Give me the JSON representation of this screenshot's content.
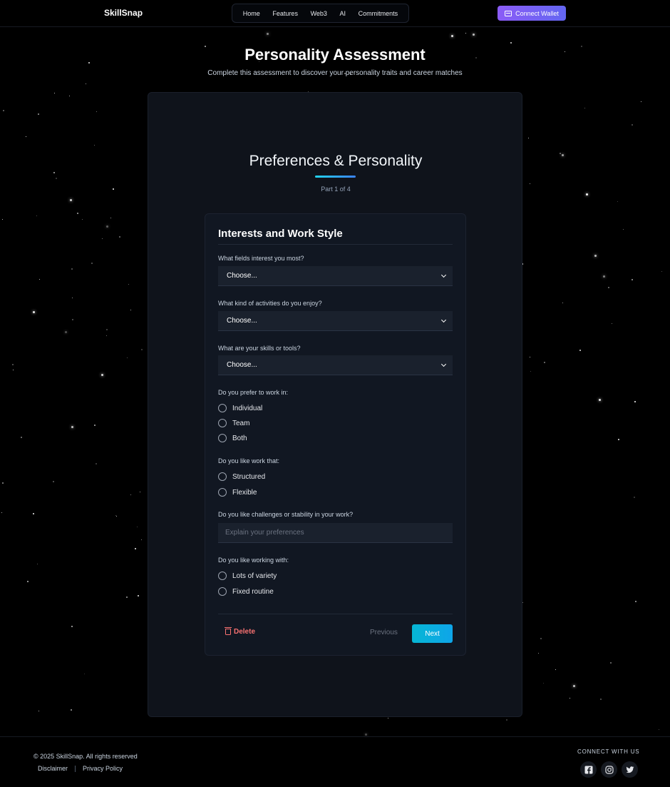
{
  "nav": {
    "brand": "SkillSnap",
    "links": [
      "Home",
      "Features",
      "Web3",
      "AI",
      "Commitments"
    ],
    "wallet_button": "Connect Wallet"
  },
  "header": {
    "title": "Personality Assessment",
    "subtitle": "Complete this assessment to discover your personality traits and career matches"
  },
  "section": {
    "title": "Preferences & Personality",
    "part": "Part 1 of 4"
  },
  "form": {
    "title": "Interests and Work Style",
    "q1": {
      "label": "What fields interest you most?",
      "value": "Choose..."
    },
    "q2": {
      "label": "What kind of activities do you enjoy?",
      "value": "Choose..."
    },
    "q3": {
      "label": "What are your skills or tools?",
      "value": "Choose..."
    },
    "q4": {
      "label": "Do you prefer to work in:",
      "options": [
        "Individual",
        "Team",
        "Both"
      ]
    },
    "q5": {
      "label": "Do you like work that:",
      "options": [
        "Structured",
        "Flexible"
      ]
    },
    "q6": {
      "label": "Do you like challenges or stability in your work?",
      "placeholder": "Explain your preferences"
    },
    "q7": {
      "label": "Do you like working with:",
      "options": [
        "Lots of variety",
        "Fixed routine"
      ]
    },
    "delete_label": "Delete",
    "previous_label": "Previous",
    "next_label": "Next"
  },
  "footer": {
    "copyright": "© 2025 SkillSnap. All rights reserved",
    "links": [
      "Disclaimer",
      "Privacy Policy"
    ],
    "connect_label": "CONNECT WITH US",
    "social_icons": [
      "facebook-icon",
      "instagram-icon",
      "twitter-icon"
    ]
  },
  "colors": {
    "background": "#000000",
    "card": "#0f131b",
    "accent_purple": "#8b5cf6",
    "accent_cyan": "#06b6d4",
    "danger": "#f87171"
  }
}
